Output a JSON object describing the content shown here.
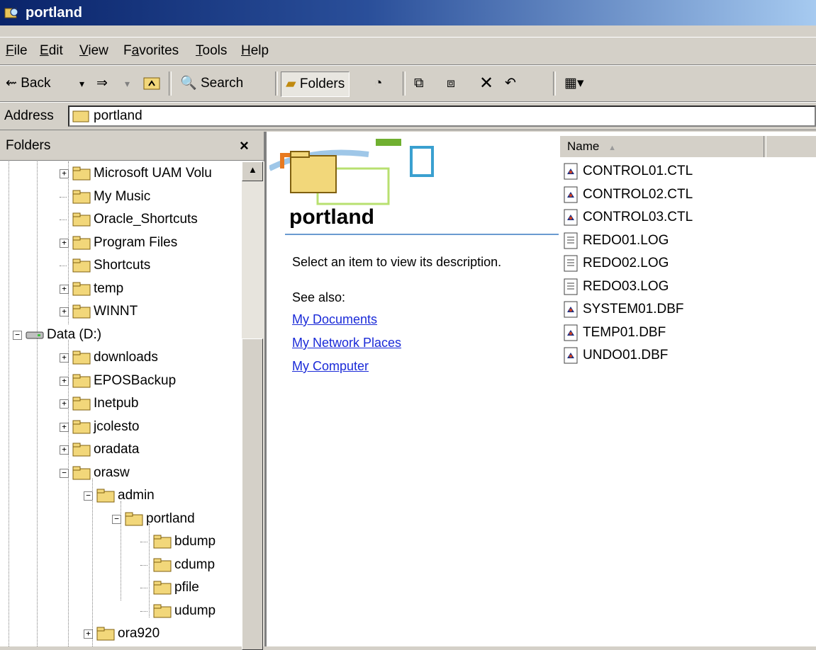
{
  "window": {
    "title": "portland"
  },
  "menu": [
    {
      "label": "File",
      "key": "F",
      "rest": "ile"
    },
    {
      "label": "Edit",
      "key": "E",
      "rest": "dit"
    },
    {
      "label": "View",
      "key": "V",
      "rest": "iew"
    },
    {
      "label": "Favorites",
      "pre": "F",
      "key": "a",
      "rest": "vorites"
    },
    {
      "label": "Tools",
      "key": "T",
      "rest": "ools"
    },
    {
      "label": "Help",
      "key": "H",
      "rest": "elp"
    }
  ],
  "toolbar": {
    "back_label": "Back",
    "search_label": "Search",
    "folders_label": "Folders"
  },
  "address": {
    "label": "Address",
    "value": "portland"
  },
  "folders_pane": {
    "title": "Folders",
    "close_glyph": "×",
    "items": [
      {
        "label": "Microsoft UAM Volu",
        "expander": "+"
      },
      {
        "label": "My Music"
      },
      {
        "label": "Oracle_Shortcuts"
      },
      {
        "label": "Program Files",
        "expander": "+"
      },
      {
        "label": "Shortcuts"
      },
      {
        "label": "temp",
        "expander": "+"
      },
      {
        "label": "WINNT",
        "expander": "+"
      },
      {
        "label": "Data (D:)",
        "expander": "−"
      },
      {
        "label": "downloads",
        "expander": "+"
      },
      {
        "label": "EPOSBackup",
        "expander": "+"
      },
      {
        "label": "Inetpub",
        "expander": "+"
      },
      {
        "label": "jcolesto",
        "expander": "+"
      },
      {
        "label": "oradata",
        "expander": "+"
      },
      {
        "label": "orasw",
        "expander": "−"
      },
      {
        "label": "admin",
        "expander": "−"
      },
      {
        "label": "portland",
        "expander": "−"
      },
      {
        "label": "bdump"
      },
      {
        "label": "cdump"
      },
      {
        "label": "pfile"
      },
      {
        "label": "udump"
      },
      {
        "label": "ora920",
        "expander": "+"
      }
    ]
  },
  "content": {
    "folder_name": "portland",
    "description": "Select an item to view its description.",
    "see_also": "See also:",
    "links": [
      "My Documents",
      "My Network Places",
      "My Computer"
    ],
    "column_name": "Name",
    "sort_indicator": "▲",
    "files": [
      {
        "name": "CONTROL01.CTL",
        "icon": "system-file-icon"
      },
      {
        "name": "CONTROL02.CTL",
        "icon": "system-file-icon"
      },
      {
        "name": "CONTROL03.CTL",
        "icon": "system-file-icon"
      },
      {
        "name": "REDO01.LOG",
        "icon": "text-file-icon"
      },
      {
        "name": "REDO02.LOG",
        "icon": "text-file-icon"
      },
      {
        "name": "REDO03.LOG",
        "icon": "text-file-icon"
      },
      {
        "name": "SYSTEM01.DBF",
        "icon": "system-file-icon"
      },
      {
        "name": "TEMP01.DBF",
        "icon": "system-file-icon"
      },
      {
        "name": "UNDO01.DBF",
        "icon": "system-file-icon"
      }
    ]
  },
  "colors": {
    "title_start": "#0a246a",
    "title_end": "#a6caf0",
    "link": "#1a2ad8",
    "folder": "#f2d77a"
  }
}
